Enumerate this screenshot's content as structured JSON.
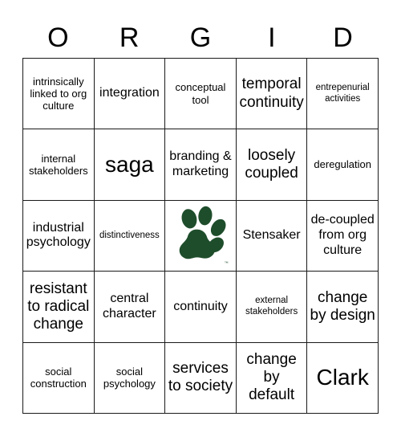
{
  "card": {
    "title_letters": [
      "O",
      "R",
      "G",
      "I",
      "D"
    ],
    "colors": {
      "paw_green": "#1E4D2B",
      "border": "#1a1a1a",
      "background": "#ffffff",
      "text": "#000000"
    },
    "free_space": {
      "type": "image",
      "icon": "paw-print-logo",
      "trademark": "™"
    },
    "rows": [
      [
        {
          "text": "intrinsically linked to org culture",
          "size": "fs-s"
        },
        {
          "text": "integration",
          "size": "fs-m"
        },
        {
          "text": "conceptual tool",
          "size": "fs-s"
        },
        {
          "text": "temporal continuity",
          "size": "fs-l"
        },
        {
          "text": "entrepenurial activities",
          "size": "fs-xs"
        }
      ],
      [
        {
          "text": "internal stakeholders",
          "size": "fs-s"
        },
        {
          "text": "saga",
          "size": "fs-xl"
        },
        {
          "text": "branding & marketing",
          "size": "fs-m"
        },
        {
          "text": "loosely coupled",
          "size": "fs-l"
        },
        {
          "text": "deregulation",
          "size": "fs-s"
        }
      ],
      [
        {
          "text": "industrial psychology",
          "size": "fs-m"
        },
        {
          "text": "distinctiveness",
          "size": "fs-xs"
        },
        {
          "text": "",
          "size": "free"
        },
        {
          "text": "Stensaker",
          "size": "fs-m"
        },
        {
          "text": "de-coupled from org culture",
          "size": "fs-m"
        }
      ],
      [
        {
          "text": "resistant to radical change",
          "size": "fs-l"
        },
        {
          "text": "central character",
          "size": "fs-m"
        },
        {
          "text": "continuity",
          "size": "fs-m"
        },
        {
          "text": "external stakeholders",
          "size": "fs-xs"
        },
        {
          "text": "change by design",
          "size": "fs-l"
        }
      ],
      [
        {
          "text": "social construction",
          "size": "fs-s"
        },
        {
          "text": "social psychology",
          "size": "fs-s"
        },
        {
          "text": "services to society",
          "size": "fs-l"
        },
        {
          "text": "change by default",
          "size": "fs-l"
        },
        {
          "text": "Clark",
          "size": "fs-xl"
        }
      ]
    ]
  }
}
